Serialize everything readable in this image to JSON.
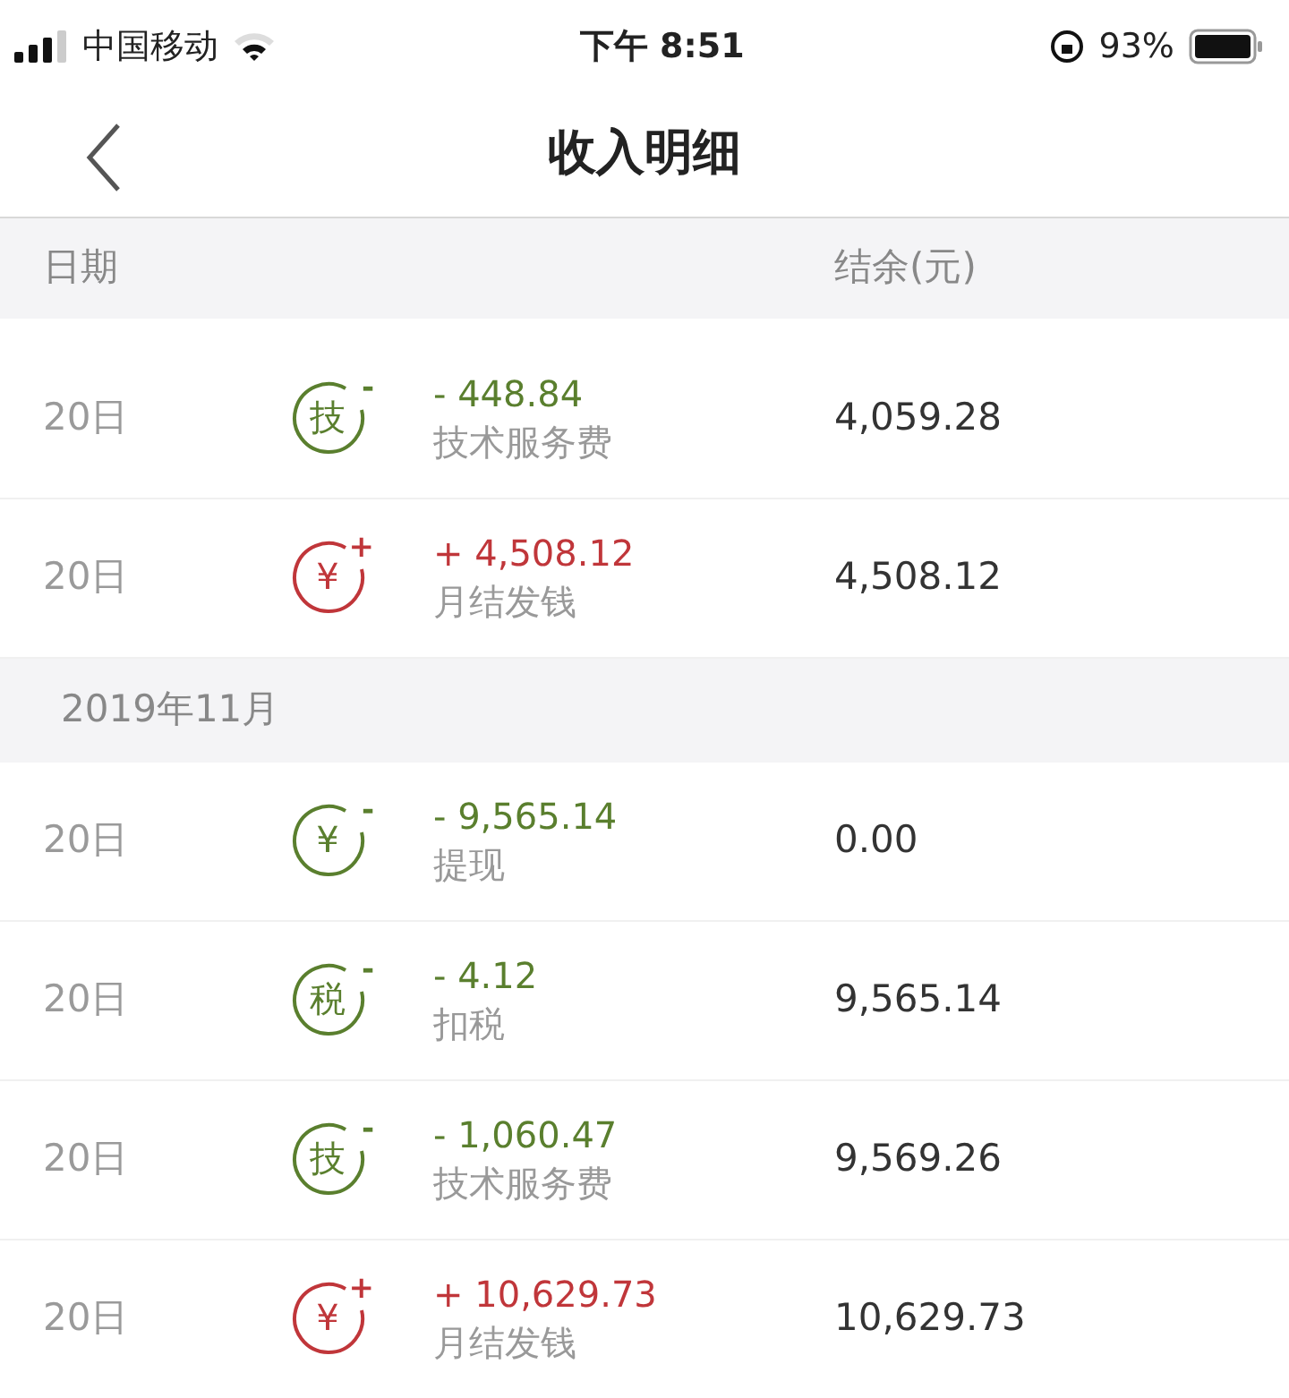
{
  "status_bar": {
    "carrier": "中国移动",
    "time": "下午 8:51",
    "battery": "93%"
  },
  "nav": {
    "title": "收入明细"
  },
  "header": {
    "date": "日期",
    "balance": "结余(元)"
  },
  "groups": [
    {
      "rows": [
        {
          "date": "20日",
          "kind": "expense",
          "icon_text": "技",
          "icon_sign": "-",
          "amount": "- 448.84",
          "label": "技术服务费",
          "balance": "4,059.28"
        },
        {
          "date": "20日",
          "kind": "income",
          "icon_text": "¥",
          "icon_sign": "+",
          "amount": "+ 4,508.12",
          "label": "月结发钱",
          "balance": "4,508.12"
        }
      ]
    },
    {
      "month": "2019年11月",
      "rows": [
        {
          "date": "20日",
          "kind": "expense",
          "icon_text": "¥",
          "icon_sign": "-",
          "amount": "- 9,565.14",
          "label": "提现",
          "balance": "0.00"
        },
        {
          "date": "20日",
          "kind": "expense",
          "icon_text": "税",
          "icon_sign": "-",
          "amount": "- 4.12",
          "label": "扣税",
          "balance": "9,565.14"
        },
        {
          "date": "20日",
          "kind": "expense",
          "icon_text": "技",
          "icon_sign": "-",
          "amount": "- 1,060.47",
          "label": "技术服务费",
          "balance": "9,569.26"
        },
        {
          "date": "20日",
          "kind": "income",
          "icon_text": "¥",
          "icon_sign": "+",
          "amount": "+ 10,629.73",
          "label": "月结发钱",
          "balance": "10,629.73"
        }
      ]
    }
  ]
}
